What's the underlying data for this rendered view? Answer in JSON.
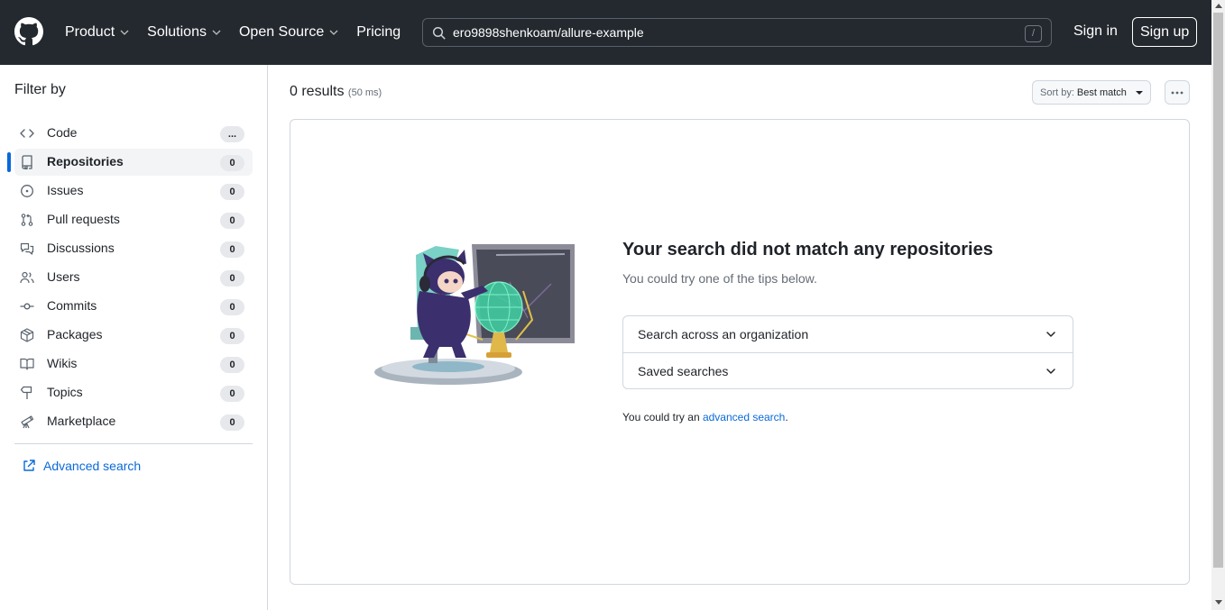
{
  "header": {
    "nav": [
      {
        "label": "Product",
        "has_dropdown": true
      },
      {
        "label": "Solutions",
        "has_dropdown": true
      },
      {
        "label": "Open Source",
        "has_dropdown": true
      },
      {
        "label": "Pricing",
        "has_dropdown": false
      }
    ],
    "search": {
      "value": "ero9898shenkoam/allure-example",
      "shortcut": "/"
    },
    "sign_in": "Sign in",
    "sign_up": "Sign up"
  },
  "sidebar": {
    "title": "Filter by",
    "items": [
      {
        "label": "Code",
        "count": "...",
        "icon": "code-icon",
        "active": false
      },
      {
        "label": "Repositories",
        "count": "0",
        "icon": "repo-icon",
        "active": true
      },
      {
        "label": "Issues",
        "count": "0",
        "icon": "issue-icon",
        "active": false
      },
      {
        "label": "Pull requests",
        "count": "0",
        "icon": "pull-request-icon",
        "active": false
      },
      {
        "label": "Discussions",
        "count": "0",
        "icon": "discussion-icon",
        "active": false
      },
      {
        "label": "Users",
        "count": "0",
        "icon": "people-icon",
        "active": false
      },
      {
        "label": "Commits",
        "count": "0",
        "icon": "commit-icon",
        "active": false
      },
      {
        "label": "Packages",
        "count": "0",
        "icon": "package-icon",
        "active": false
      },
      {
        "label": "Wikis",
        "count": "0",
        "icon": "book-icon",
        "active": false
      },
      {
        "label": "Topics",
        "count": "0",
        "icon": "tag-icon",
        "active": false
      },
      {
        "label": "Marketplace",
        "count": "0",
        "icon": "telescope-icon",
        "active": false
      }
    ],
    "advanced_search": "Advanced search"
  },
  "main": {
    "results": "0 results",
    "timing": "(50 ms)",
    "sort_label": "Sort by:",
    "sort_value": "Best match",
    "empty": {
      "title": "Your search did not match any repositories",
      "subtitle": "You could try one of the tips below.",
      "tips": [
        "Search across an organization",
        "Saved searches"
      ],
      "try_prefix": "You could try an ",
      "try_link": "advanced search",
      "try_suffix": "."
    }
  },
  "colors": {
    "header_bg": "#24292f",
    "accent": "#0969da",
    "border": "#d0d7de"
  }
}
